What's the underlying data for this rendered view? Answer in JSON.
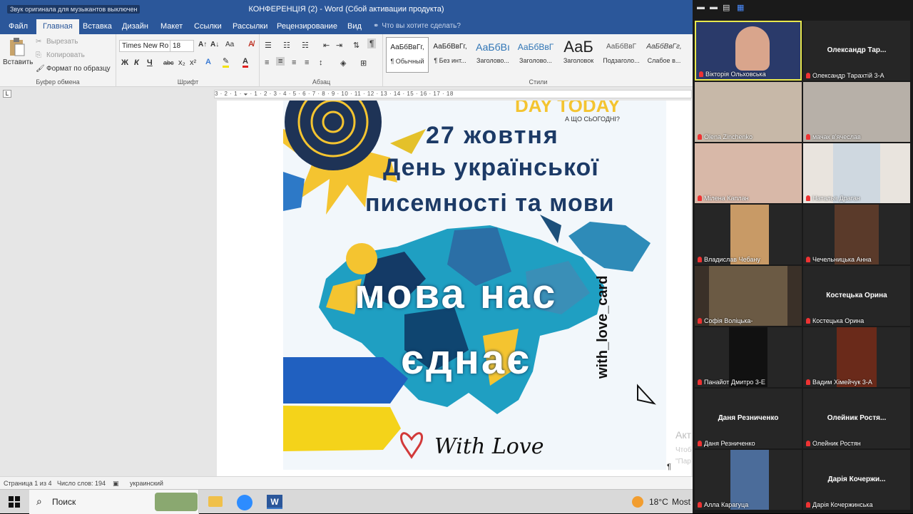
{
  "word": {
    "qat_text": "Звук оригинала для музыкантов выключен",
    "doc_title": "КОНФЕРЕНЦІЯ (2) - Word (Сбой активации продукта)",
    "tabs": [
      "Файл",
      "Главная",
      "Вставка",
      "Дизайн",
      "Макет",
      "Ссылки",
      "Рассылки",
      "Рецензирование",
      "Вид"
    ],
    "tell_me": "Что вы хотите сделать?",
    "clipboard": {
      "paste": "Вставить",
      "cut": "Вырезать",
      "copy": "Копировать",
      "format_painter": "Формат по образцу",
      "label": "Буфер обмена"
    },
    "font": {
      "name": "Times New Ro",
      "size": "18",
      "label": "Шрифт",
      "bold": "Ж",
      "italic": "К",
      "underline": "Ч",
      "strike": "abc",
      "sub": "x₂",
      "sup": "x²",
      "case": "Aa"
    },
    "paragraph": {
      "label": "Абзац",
      "pilcrow": "¶"
    },
    "styles": {
      "label": "Стили",
      "items": [
        {
          "preview": "АаБбВвГг,",
          "name": "¶ Обычный"
        },
        {
          "preview": "АаБбВвГг,",
          "name": "¶ Без инт..."
        },
        {
          "preview": "АаБбВı",
          "name": "Заголово..."
        },
        {
          "preview": "АаБбВвГ",
          "name": "Заголово..."
        },
        {
          "preview": "АаБ",
          "name": "Заголовок"
        },
        {
          "preview": "АаБбВвГ",
          "name": "Подзаголо..."
        },
        {
          "preview": "АаБбВвГг,",
          "name": "Слабое в..."
        }
      ]
    },
    "ruler_marks": "3 · 2 · 1 · 🞃 · 1 · 2 · 3 · 4 · 5 · 6 · 7 · 8 · 9 · 10 · 11 · 12 · 13 · 14 · 15 · 16 · 17 · 18",
    "status": {
      "page": "Страница 1 из 4",
      "words": "Число слов: 194",
      "lang": "украинский"
    },
    "activate": {
      "line1": "Акт",
      "line2": "Чтоб",
      "line3": "\"Пар"
    },
    "pilcrow_end": "¶"
  },
  "poster": {
    "top_text": "DAY TODAY",
    "subtitle": "А ЩО СЬОГОДНІ?",
    "date_line": "27 жовтня",
    "line2": "День української",
    "line3": "писемності та мови",
    "slogan1": "мова нас",
    "slogan2": "єднає",
    "handle": "with_love_card",
    "signature": "With Love"
  },
  "zoom": {
    "participants": [
      {
        "label": "Вікторія Ольховська",
        "big": ""
      },
      {
        "label": "Олександр Тарахтій 3-А",
        "big": "Олександр  Тар..."
      },
      {
        "label": "Olena Zinchenko",
        "big": ""
      },
      {
        "label": "мачак в'ячеслав",
        "big": ""
      },
      {
        "label": "Мілена Каплан",
        "big": ""
      },
      {
        "label": "Наталья Драган",
        "big": ""
      },
      {
        "label": "Владислав Чебану",
        "big": ""
      },
      {
        "label": "Чечельницька Анна",
        "big": ""
      },
      {
        "label": "Софія Воліцька-",
        "big": ""
      },
      {
        "label": "Костецька Орина",
        "big": "Костецька Орина"
      },
      {
        "label": "Панайот Дмитро 3-Е",
        "big": ""
      },
      {
        "label": "Вадим Хімейчук 3-А",
        "big": ""
      },
      {
        "label": "Даня Резниченко",
        "big": "Даня Резниченко"
      },
      {
        "label": "Олейник Ростян",
        "big": "Олейник  Ростя..."
      },
      {
        "label": "Алла Карагуца",
        "big": ""
      },
      {
        "label": "Дарія Кочержинська",
        "big": "Дарія  Кочержи..."
      }
    ]
  },
  "taskbar": {
    "search": "Поиск",
    "temp": "18°C",
    "weather": "Most"
  }
}
